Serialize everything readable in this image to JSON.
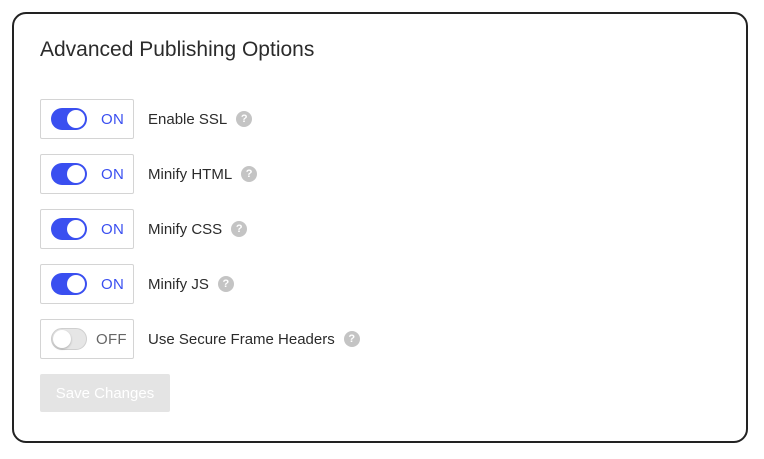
{
  "panel": {
    "title": "Advanced Publishing Options"
  },
  "options": [
    {
      "label": "Enable SSL",
      "state": "ON",
      "enabled": true,
      "help_icon": "question-mark"
    },
    {
      "label": "Minify HTML",
      "state": "ON",
      "enabled": true,
      "help_icon": "question-mark"
    },
    {
      "label": "Minify CSS",
      "state": "ON",
      "enabled": true,
      "help_icon": "question-mark"
    },
    {
      "label": "Minify JS",
      "state": "ON",
      "enabled": true,
      "help_icon": "question-mark"
    },
    {
      "label": "Use Secure Frame Headers",
      "state": "OFF",
      "enabled": false,
      "help_icon": "question-mark"
    }
  ],
  "help_glyph": "?",
  "save_button": {
    "label": "Save Changes",
    "disabled": true
  },
  "colors": {
    "accent": "#3a4ff0",
    "disabled_button": "#e4e4e4",
    "help_icon": "#c4c4c4"
  }
}
